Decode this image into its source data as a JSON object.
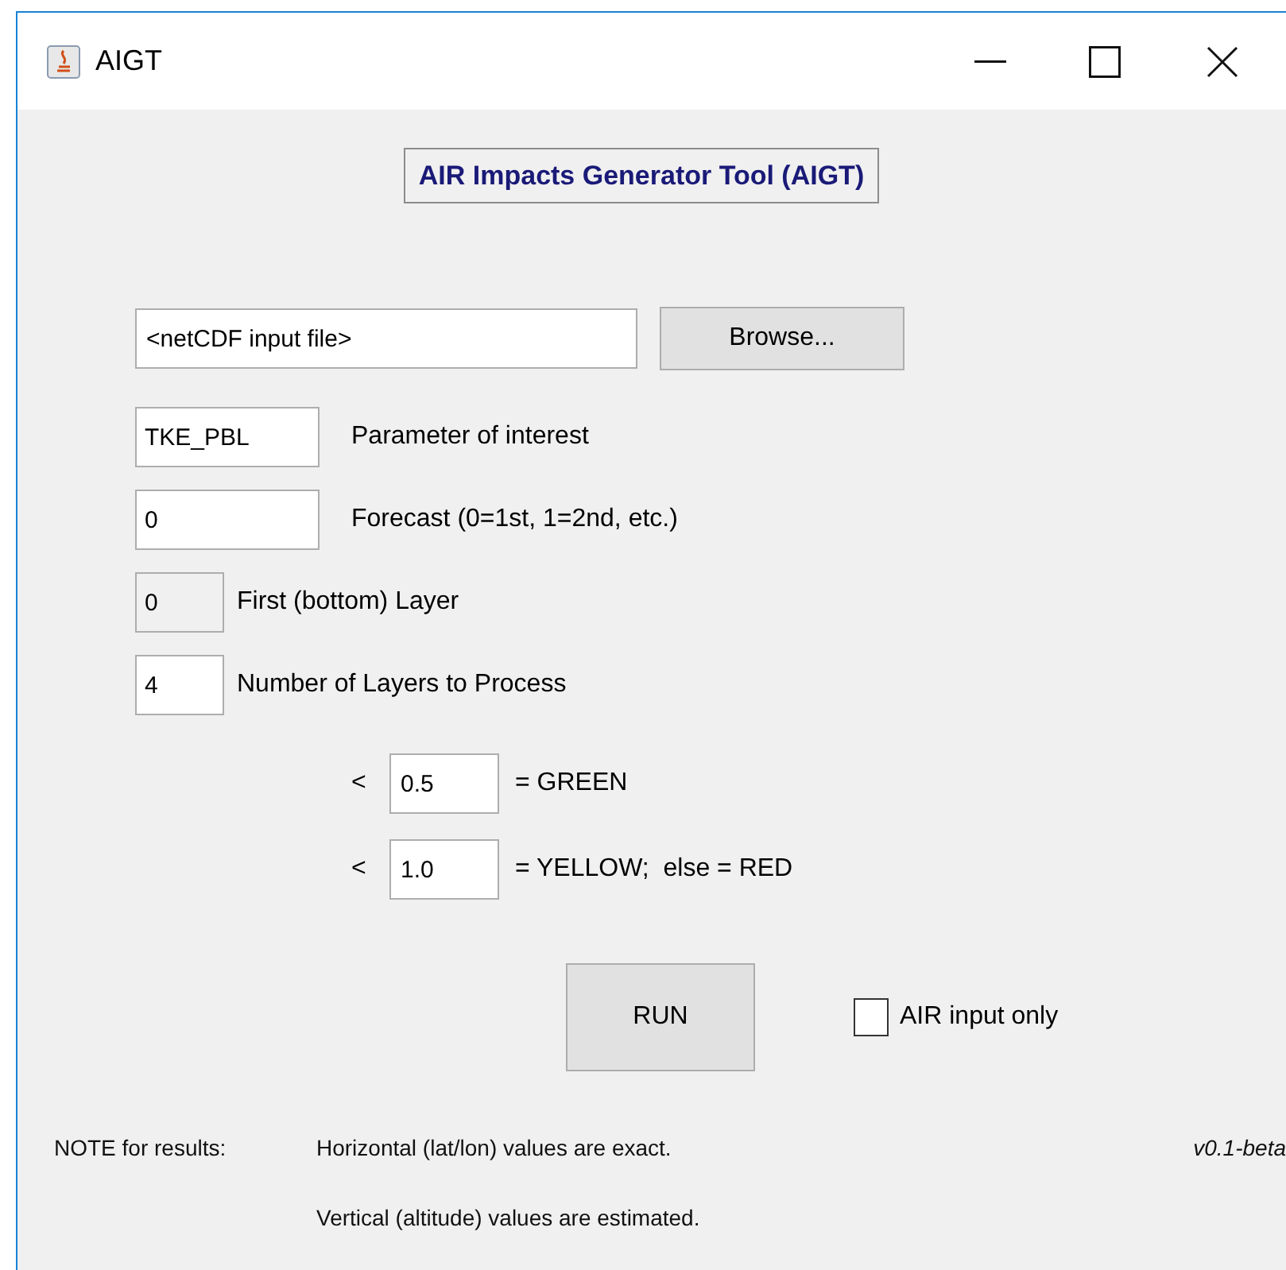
{
  "window": {
    "title": "AIGT"
  },
  "heading": "AIR Impacts Generator Tool (AIGT)",
  "file_input": {
    "value": "<netCDF input file>",
    "button": "Browse..."
  },
  "fields": [
    {
      "value": "TKE_PBL",
      "label": "Parameter of interest",
      "disabled": false,
      "kind": "wide"
    },
    {
      "value": "0",
      "label": "Forecast (0=1st, 1=2nd, etc.)",
      "disabled": false,
      "kind": "wide"
    },
    {
      "value": "0",
      "label": "First (bottom) Layer",
      "disabled": true,
      "kind": "narrow"
    },
    {
      "value": "4",
      "label": "Number of Layers to Process",
      "disabled": false,
      "kind": "narrow"
    }
  ],
  "thresholds": [
    {
      "prefix": "<",
      "value": "0.5",
      "label": "= GREEN"
    },
    {
      "prefix": "<",
      "value": "1.0",
      "label": "= YELLOW;  else = RED"
    }
  ],
  "run_button": "RUN",
  "air_input_only": {
    "label": "AIR input only",
    "checked": false
  },
  "notes": {
    "prefix": "NOTE for results:",
    "line_1": "Horizontal (lat/lon) values are exact.",
    "line_2": "Vertical (altitude) values are estimated.",
    "version": "v0.1-beta"
  }
}
